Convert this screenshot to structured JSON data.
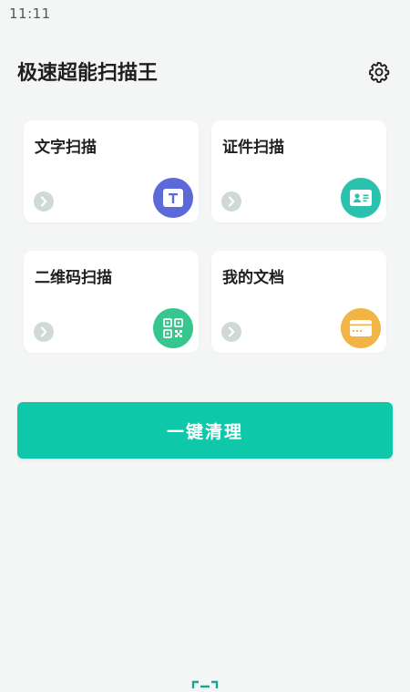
{
  "status_bar": {
    "time": "11:11"
  },
  "header": {
    "title": "极速超能扫描王",
    "settings_icon": "gear-icon"
  },
  "cards": [
    {
      "title": "文字扫描",
      "icon": "text-scan-icon",
      "icon_color": "#5b69d9"
    },
    {
      "title": "证件扫描",
      "icon": "id-card-icon",
      "icon_color": "#2ac2ae"
    },
    {
      "title": "二维码扫描",
      "icon": "qr-code-icon",
      "icon_color": "#37c68e"
    },
    {
      "title": "我的文档",
      "icon": "folder-icon",
      "icon_color": "#f2b444"
    }
  ],
  "clean_button": {
    "label": "一键清理",
    "color": "#0fc7a9"
  },
  "colors": {
    "background": "#f4f5f5",
    "arrow_bg": "#cfd9d7"
  }
}
